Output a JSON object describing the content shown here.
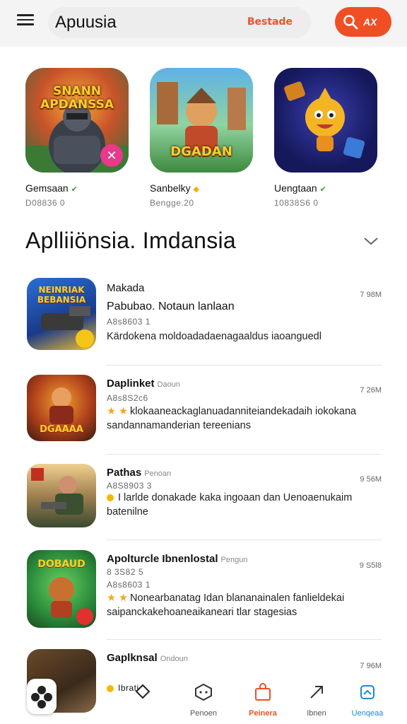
{
  "header": {
    "search_placeholder": "Apuusia",
    "search_tag": "Bestade",
    "search_button_label": "AX",
    "colors": {
      "accent": "#f04f24",
      "header_bg": "#f4f4f4"
    }
  },
  "featured": [
    {
      "name": "Gemsaan",
      "meta": "D08836 0",
      "art_text": "SNANN APDANSSA",
      "badge_icon": "tools-icon"
    },
    {
      "name": "Sanbelky",
      "meta": "Bengge.20",
      "art_text": "DGADAN"
    },
    {
      "name": "Uengtaan",
      "meta": "10838S6 0",
      "art_text": ""
    }
  ],
  "section": {
    "title": "Aplliiönsia. Imdansia"
  },
  "list": [
    {
      "art_text": "NEINRIAK BEBANSIA",
      "title": "Makada",
      "subtitle": "Pabubao. Notaun lanlaan",
      "meta1": "A8s8603 1",
      "desc": "Kärdokena moldoadadaenagaaldus iaoanguedl",
      "size": "7 98M"
    },
    {
      "art_text": "DGAAAA",
      "title": "Daplinket",
      "title_sub": "Daoun",
      "meta1": "A8s8S2c6",
      "desc": "klokaaneackaglanuadanniteiandekadaih iokokana sandannamanderian tereenians",
      "stars": "★ ★",
      "size": "7 26M"
    },
    {
      "title": "Pathas",
      "title_sub": "Penoan",
      "meta1": "A8S8903 3",
      "desc": "I larlde donakade kaka ingoaan dan Uenoaenukaim batenilne",
      "size": "9 56M"
    },
    {
      "art_text": "DOBAUD",
      "title": "Apolturcle Ibnenlostal",
      "title_sub": "Pengun",
      "meta0": "8 3S82 5",
      "meta1": "A8s8603 1",
      "desc": "Nonearbanatag Idan blananainalen fanlieldekai saipanckakehoaneaikaneari tlar stagesias",
      "stars": "★ ★",
      "size": "9 S5l8"
    },
    {
      "title": "Gaplknsal",
      "title_sub": "Ondoun",
      "meta1": "Ibrati",
      "size": "7 96M"
    }
  ],
  "bottom_nav": [
    {
      "label": "",
      "icon": "diamond-icon"
    },
    {
      "label": "Penoen",
      "icon": "dice-icon"
    },
    {
      "label": "Peinera",
      "icon": "bag-icon",
      "active": true
    },
    {
      "label": "Ibnen",
      "icon": "arrow-diagonal-icon"
    },
    {
      "label": "Uenqeaa",
      "icon": "store-icon"
    }
  ]
}
